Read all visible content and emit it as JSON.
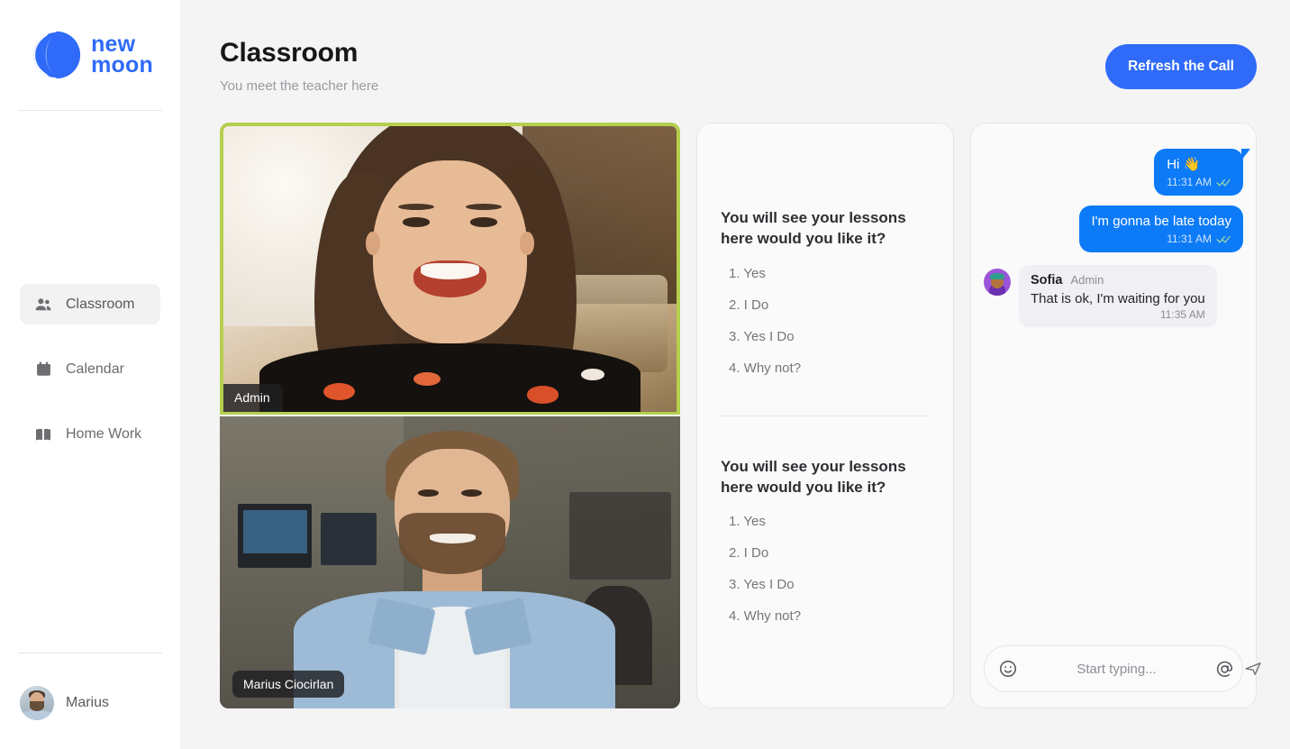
{
  "brand": {
    "line1": "new",
    "line2": "moon",
    "color": "#2f6bf8",
    "logo_icon": "moon-arcs-logo"
  },
  "sidebar": {
    "items": [
      {
        "label": "Classroom",
        "icon": "people-icon",
        "active": true
      },
      {
        "label": "Calendar",
        "icon": "calendar-icon",
        "active": false
      },
      {
        "label": "Home Work",
        "icon": "book-icon",
        "active": false
      }
    ],
    "user": {
      "name": "Marius",
      "avatar_icon": "user-avatar-photo"
    }
  },
  "header": {
    "title": "Classroom",
    "subtitle": "You meet the teacher here",
    "refresh_label": "Refresh the Call",
    "accent": "#2f6bf8"
  },
  "video": {
    "tiles": [
      {
        "label": "Admin",
        "active_speaker": true,
        "border_color": "#b5cf4e"
      },
      {
        "label": "Marius Ciocirlan",
        "active_speaker": false
      }
    ]
  },
  "lessons": {
    "blocks": [
      {
        "title": "You will see your lessons here would you like it?",
        "options": [
          "1. Yes",
          "2. I Do",
          "3. Yes I Do",
          "4. Why not?"
        ]
      },
      {
        "title": "You will see your lessons here would you like it?",
        "options": [
          "1. Yes",
          "2. I Do",
          "3. Yes I Do",
          "4. Why not?"
        ]
      }
    ]
  },
  "chat": {
    "bubble_color": "#0d7bf7",
    "messages": [
      {
        "side": "out",
        "text": "Hi  👋",
        "time": "11:31 AM",
        "status_icon": "double-check-icon",
        "tail": true
      },
      {
        "side": "out",
        "text": "I'm gonna be late today",
        "time": "11:31 AM",
        "status_icon": "double-check-icon",
        "tail": false
      },
      {
        "side": "in",
        "name": "Sofia",
        "role": "Admin",
        "text": "That is ok, I'm waiting for you",
        "time": "11:35 AM",
        "avatar_icon": "sofia-avatar"
      }
    ],
    "composer": {
      "placeholder": "Start typing...",
      "value": "",
      "emoji_icon": "smiley-icon",
      "mention_icon": "at-sign-icon",
      "send_icon": "send-plane-icon"
    }
  }
}
